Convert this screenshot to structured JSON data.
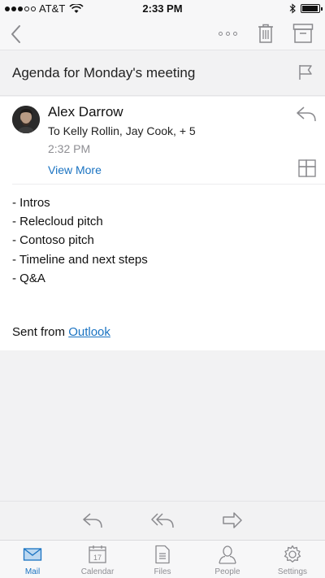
{
  "status_bar": {
    "carrier": "AT&T",
    "time": "2:33 PM"
  },
  "toolbar": {
    "back_icon": "chevron-left-icon",
    "more_icon": "more-dots-icon",
    "delete_icon": "trash-icon",
    "archive_icon": "archive-icon"
  },
  "email": {
    "subject": "Agenda for Monday's meeting",
    "sender": "Alex Darrow",
    "recipients": "To Kelly Rollin, Jay Cook, + 5",
    "time": "2:32 PM",
    "view_more": "View More",
    "body_lines": [
      "- Intros",
      "- Relecloud pitch",
      "- Contoso pitch",
      "- Timeline and next steps",
      "- Q&A"
    ],
    "signature_prefix": "Sent from ",
    "signature_link": "Outlook"
  },
  "tabs": [
    {
      "label": "Mail",
      "icon": "mail-icon",
      "active": true
    },
    {
      "label": "Calendar",
      "icon": "calendar-icon",
      "day": "17"
    },
    {
      "label": "Files",
      "icon": "files-icon"
    },
    {
      "label": "People",
      "icon": "people-icon"
    },
    {
      "label": "Settings",
      "icon": "gear-icon"
    }
  ],
  "colors": {
    "accent": "#1a73c2",
    "icon_gray": "#8a8a8e"
  }
}
